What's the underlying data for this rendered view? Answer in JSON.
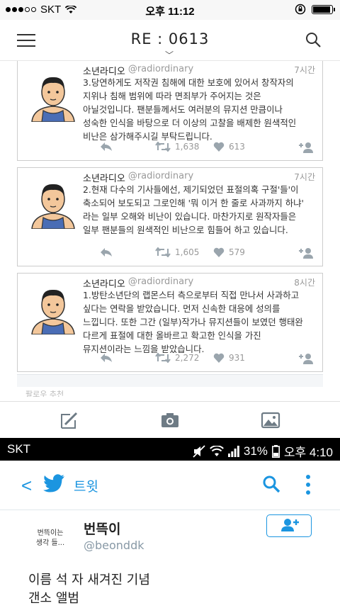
{
  "ios_status": {
    "carrier": "SKT",
    "time": "오후 11:12"
  },
  "header": {
    "title": "RE : 0613"
  },
  "tweets": [
    {
      "name": "소년라디오",
      "handle": "@radiordinary",
      "time": "7시간",
      "text": "3.당연하게도 저작권 침해에 대한 보호에 있어서 창작자의\n지위나 침해 범위에 따라 면죄부가 주어지는 것은\n아닐것입니다. 팬분들께서도 여러분의 뮤지션 만큼이나\n성숙한 인식을 바탕으로 더 이상의 고찰을 배제한 원색적인\n비난은 삼가해주시길 부탁드립니다.",
      "retweets": "1,638",
      "likes": "613"
    },
    {
      "name": "소년라디오",
      "handle": "@radiordinary",
      "time": "7시간",
      "text": "2.현재 다수의 기사들에선, 제기되었던 표절의혹 구절'들'이\n축소되어 보도되고 그로인해 '뭐 이거 한 줄로 사과까지 하냐'\n라는 일부 오해와 비난이 있습니다. 마찬가지로 원작자들은\n일부 팬분들의 원색적인 비난으로 힘들어 하고 있습니다.",
      "retweets": "1,605",
      "likes": "579"
    },
    {
      "name": "소년라디오",
      "handle": "@radiordinary",
      "time": "8시간",
      "text": "1.방탄소년단의 랩몬스터 측으로부터 직접 만나서 사과하고\n싶다는 연락을 받았습니다. 먼저 신속한 대응에 성의를\n느낍니다. 또한 그간 (일부)작가나 뮤지션들이 보였던 행태완\n다르게 표절에 대한 올바르고 확고한 인식을 가진\n뮤지션이라는 느낌을 받았습니다.",
      "retweets": "2,272",
      "likes": "931"
    }
  ],
  "suggest_label": "팔로우 추천",
  "android_status": {
    "carrier": "SKT",
    "battery": "31%",
    "time": "오후 4:10"
  },
  "twitter_header": {
    "title": "트윗"
  },
  "profile": {
    "avatar_text": "번뜩이는\n생각 들...",
    "name": "번뜩이",
    "handle": "@beonddk",
    "tweet_text": "이름 석 자 새겨진 기념\n갠소 앨범"
  },
  "colors": {
    "twitter_blue": "#1b95e0",
    "icon_gray": "#9aa5ad"
  }
}
